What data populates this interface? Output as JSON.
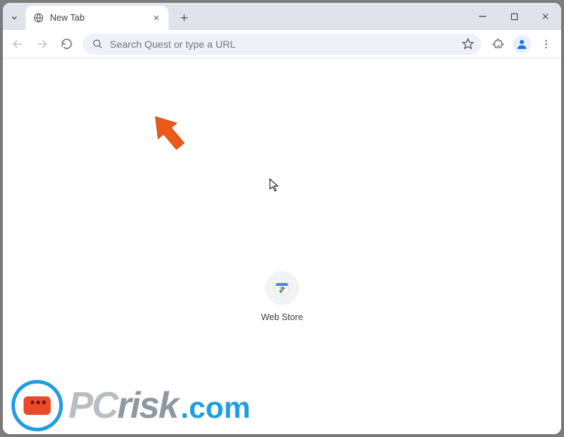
{
  "tab": {
    "title": "New Tab"
  },
  "omnibox": {
    "placeholder": "Search Quest or type a URL",
    "value": ""
  },
  "shortcut": {
    "label": "Web Store"
  },
  "watermark": {
    "brand_a": "PC",
    "brand_b": "risk",
    "tld": ".com"
  }
}
